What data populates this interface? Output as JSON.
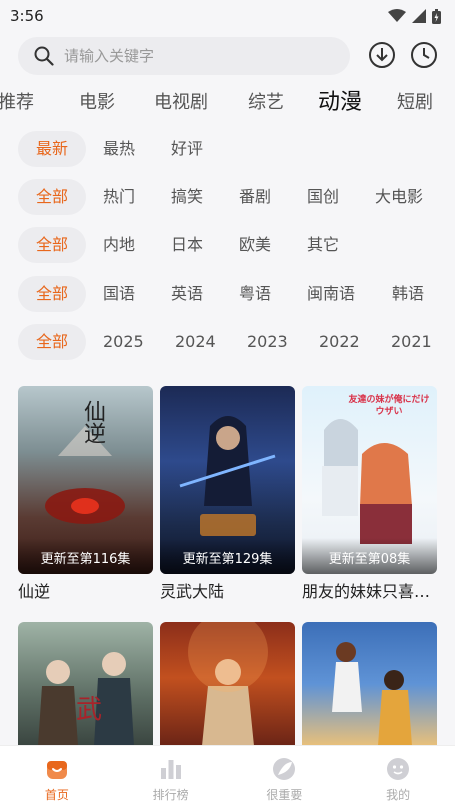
{
  "status": {
    "time": "3:56"
  },
  "search": {
    "placeholder": "请输入关键字"
  },
  "categories": [
    "推荐",
    "电影",
    "电视剧",
    "综艺",
    "动漫",
    "短剧"
  ],
  "filters": {
    "sort": [
      "最新",
      "最热",
      "好评"
    ],
    "genre": [
      "全部",
      "热门",
      "搞笑",
      "番剧",
      "国创",
      "大电影"
    ],
    "region": [
      "全部",
      "内地",
      "日本",
      "欧美",
      "其它"
    ],
    "language": [
      "全部",
      "国语",
      "英语",
      "粤语",
      "闽南语",
      "韩语"
    ],
    "year": [
      "全部",
      "2025",
      "2024",
      "2023",
      "2022",
      "2021"
    ]
  },
  "cards": [
    {
      "title": "仙逆",
      "update": "更新至第116集"
    },
    {
      "title": "灵武大陆",
      "update": "更新至第129集"
    },
    {
      "title": "朋友的妹妹只喜欢烦我",
      "update": "更新至第08集"
    },
    {
      "title": "",
      "update": ""
    },
    {
      "title": "",
      "update": ""
    },
    {
      "title": "",
      "update": ""
    }
  ],
  "poster_text": {
    "xianni": "仙逆",
    "anime_logo": "友達の妹が俺にだけウザい"
  },
  "bottom_nav": [
    {
      "label": "首页",
      "icon": "home-icon"
    },
    {
      "label": "排行榜",
      "icon": "bar-chart-icon"
    },
    {
      "label": "很重要",
      "icon": "leaf-icon"
    },
    {
      "label": "我的",
      "icon": "profile-icon"
    }
  ],
  "colors": {
    "accent": "#e8671c",
    "chip_bg": "#ececef",
    "background": "#f6f6f8"
  }
}
